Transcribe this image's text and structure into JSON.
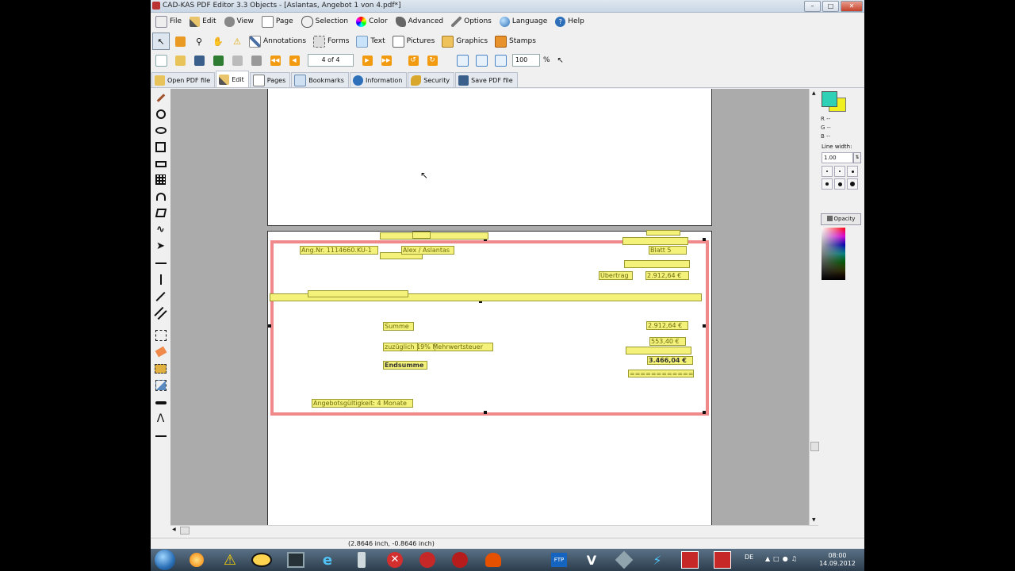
{
  "window": {
    "title": "CAD-KAS PDF Editor 3.3 Objects - [Aslantas, Angebot 1 von 4.pdf*]"
  },
  "menu": [
    {
      "label": "File",
      "icon": "file-icon"
    },
    {
      "label": "Edit",
      "icon": "pencil-icon"
    },
    {
      "label": "View",
      "icon": "eye-icon"
    },
    {
      "label": "Page",
      "icon": "page-icon"
    },
    {
      "label": "Selection",
      "icon": "lasso-icon"
    },
    {
      "label": "Color",
      "icon": "color-wheel-icon"
    },
    {
      "label": "Advanced",
      "icon": "wizard-icon"
    },
    {
      "label": "Options",
      "icon": "wrench-icon"
    },
    {
      "label": "Language",
      "icon": "globe-icon"
    },
    {
      "label": "Help",
      "icon": "help-icon"
    }
  ],
  "modes": [
    {
      "label": "Annotations"
    },
    {
      "label": "Forms"
    },
    {
      "label": "Text"
    },
    {
      "label": "Pictures"
    },
    {
      "label": "Graphics"
    },
    {
      "label": "Stamps"
    }
  ],
  "nav": {
    "page_indicator": "4 of 4",
    "zoom_value": "100",
    "zoom_unit": "%"
  },
  "tabs": [
    {
      "label": "Open PDF file"
    },
    {
      "label": "Edit"
    },
    {
      "label": "Pages"
    },
    {
      "label": "Bookmarks"
    },
    {
      "label": "Information"
    },
    {
      "label": "Security"
    },
    {
      "label": "Save PDF file"
    }
  ],
  "document": {
    "blocks": [
      {
        "text": "Ang.Nr. 1114660.KU-1"
      },
      {
        "text": "Alex / Aslantas"
      },
      {
        "text": "Blatt 5"
      },
      {
        "text": "Übertrag"
      },
      {
        "text": "2.912,64 €"
      },
      {
        "text": "Summe"
      },
      {
        "text": "2.912,64 €"
      },
      {
        "text": "zuzüglich 19% Mehrwertsteuer"
      },
      {
        "text": "553,40 €"
      },
      {
        "text": "Endsumme"
      },
      {
        "text": "3.466,04 €"
      },
      {
        "text": "============"
      },
      {
        "text": "Angebotsgültigkeit: 4 Monate"
      }
    ]
  },
  "side_panel": {
    "r_label": "R --",
    "g_label": "G --",
    "b_label": "B --",
    "line_width_label": "Line width:",
    "line_width_value": "1.00",
    "opacity_label": "Opacity",
    "primary_color": "#2ed1b5",
    "secondary_color": "#f0f021"
  },
  "status": {
    "coords": "(2.8646 inch, -0.8646 inch)"
  },
  "taskbar": {
    "language": "DE",
    "time": "08:00",
    "date": "14.09.2012"
  }
}
